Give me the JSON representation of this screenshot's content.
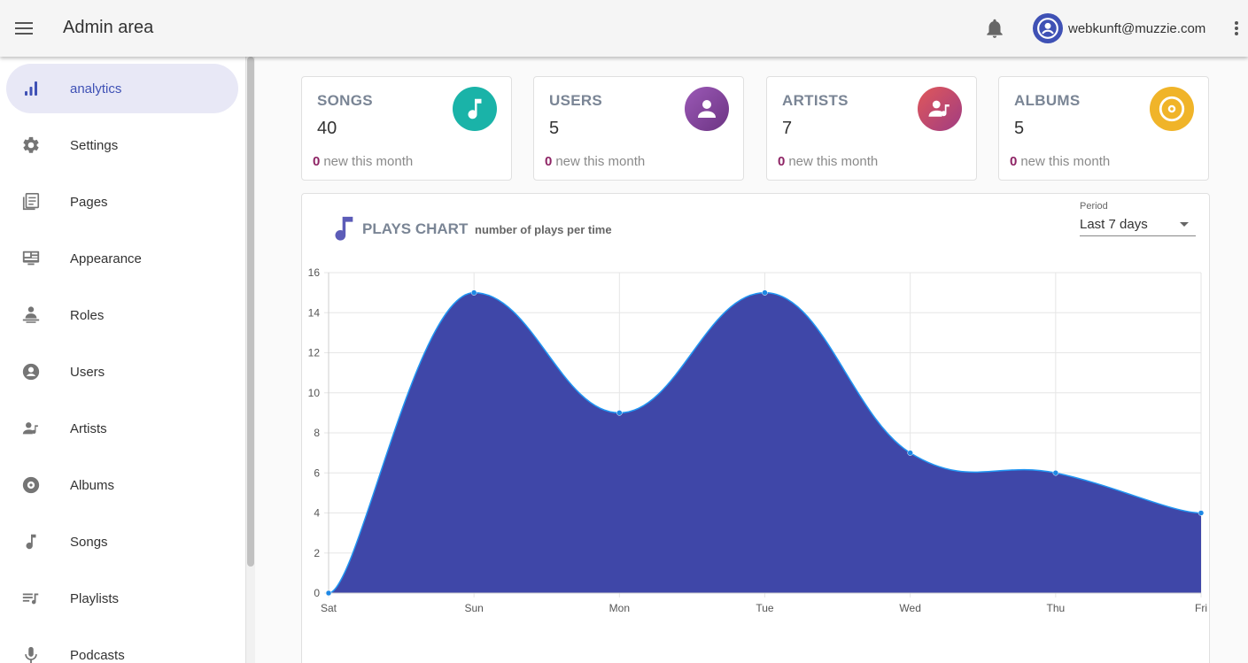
{
  "header": {
    "title": "Admin area",
    "account_email": "webkunft@muzzie.com"
  },
  "sidebar": {
    "items": [
      {
        "label": "analytics",
        "icon": "analytics-icon",
        "active": true
      },
      {
        "label": "Settings",
        "icon": "gear-icon"
      },
      {
        "label": "Pages",
        "icon": "pages-icon"
      },
      {
        "label": "Appearance",
        "icon": "monitor-icon"
      },
      {
        "label": "Roles",
        "icon": "roles-icon"
      },
      {
        "label": "Users",
        "icon": "user-circle-icon"
      },
      {
        "label": "Artists",
        "icon": "artist-icon"
      },
      {
        "label": "Albums",
        "icon": "album-icon"
      },
      {
        "label": "Songs",
        "icon": "music-note-icon"
      },
      {
        "label": "Playlists",
        "icon": "playlist-icon"
      },
      {
        "label": "Podcasts",
        "icon": "microphone-icon"
      }
    ]
  },
  "cards": [
    {
      "title": "SONGS",
      "count": "40",
      "new_count": "0",
      "new_label": "new this month",
      "icon": "music-note-icon",
      "color": "#1ab3a8"
    },
    {
      "title": "USERS",
      "count": "5",
      "new_count": "0",
      "new_label": "new this month",
      "icon": "user-icon",
      "color": "#8e44ad"
    },
    {
      "title": "ARTISTS",
      "count": "7",
      "new_count": "0",
      "new_label": "new this month",
      "icon": "artist-icon",
      "color": "#c0486e"
    },
    {
      "title": "ALBUMS",
      "count": "5",
      "new_count": "0",
      "new_label": "new this month",
      "icon": "album-icon",
      "color": "#f0b429"
    }
  ],
  "chart_panel": {
    "title": "PLAYS CHART",
    "subtitle": "number of plays per time",
    "period_label": "Period",
    "period_value": "Last 7 days"
  },
  "chart_data": {
    "type": "area",
    "categories": [
      "Sat",
      "Sun",
      "Mon",
      "Tue",
      "Wed",
      "Thu",
      "Fri"
    ],
    "series": [
      {
        "values": [
          0,
          15,
          9,
          15,
          7,
          6,
          4
        ]
      }
    ],
    "ylim": [
      0,
      16
    ],
    "y_ticks": [
      0,
      2,
      4,
      6,
      8,
      10,
      12,
      14,
      16
    ],
    "grid": true,
    "colors": {
      "fill": "#3f47a8",
      "line": "#2196f3",
      "point": "#1e88e5"
    }
  }
}
